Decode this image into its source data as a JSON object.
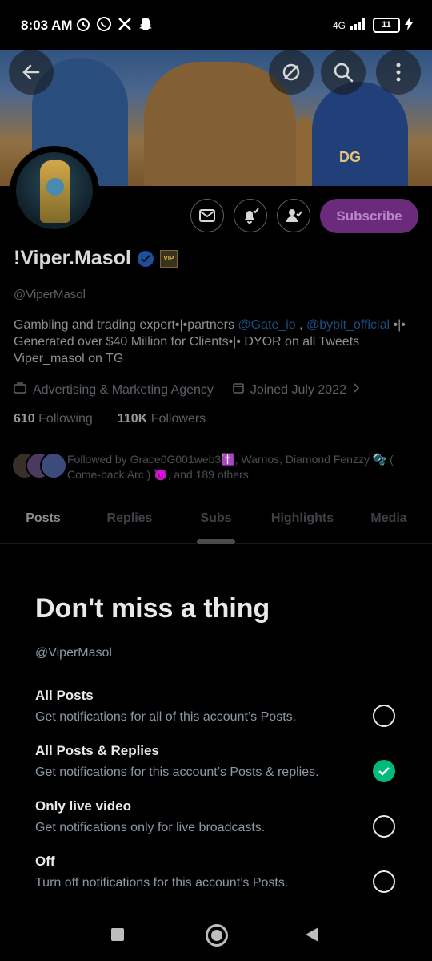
{
  "status_bar": {
    "time": "8:03 AM",
    "network": "4G",
    "battery": "11"
  },
  "profile": {
    "name": "!Viper.Masol",
    "handle": "@ViperMasol",
    "bio_part1": "Gambling and trading expert•|•partners ",
    "bio_link1": "@Gate_io",
    "bio_sep": " , ",
    "bio_link2": "@bybit_official",
    "bio_part2": "•|• Generated over $40 Million for Clients•|• DYOR on all Tweets Viper_masol on TG",
    "category": "Advertising & Marketing Agency",
    "joined": "Joined July 2022",
    "following_count": "610",
    "following_label": "Following",
    "followers_count": "110K",
    "followers_label": "Followers",
    "followed_by": "Followed by Grace0G001web3✝️, Warnos, Diamond Fenzzy 🫧 ( Come-back Arc ) 😈, and 189 others",
    "banner_text": "DG"
  },
  "actions": {
    "subscribe_label": "Subscribe"
  },
  "tabs": [
    "Posts",
    "Replies",
    "Subs",
    "Highlights",
    "Media"
  ],
  "sheet": {
    "title": "Don't miss a thing",
    "handle": "@ViperMasol",
    "options": [
      {
        "title": "All Posts",
        "desc": "Get notifications for all of this account’s Posts.",
        "selected": false
      },
      {
        "title": "All Posts & Replies",
        "desc": "Get notifications for this account’s Posts & replies.",
        "selected": true
      },
      {
        "title": "Only live video",
        "desc": "Get notifications only for live broadcasts.",
        "selected": false
      },
      {
        "title": "Off",
        "desc": "Turn off notifications for this account’s Posts.",
        "selected": false
      }
    ]
  },
  "colors": {
    "accent_subscribe": "#6b2b7c",
    "radio_selected": "#00ba7c",
    "link": "#1c4e82"
  }
}
